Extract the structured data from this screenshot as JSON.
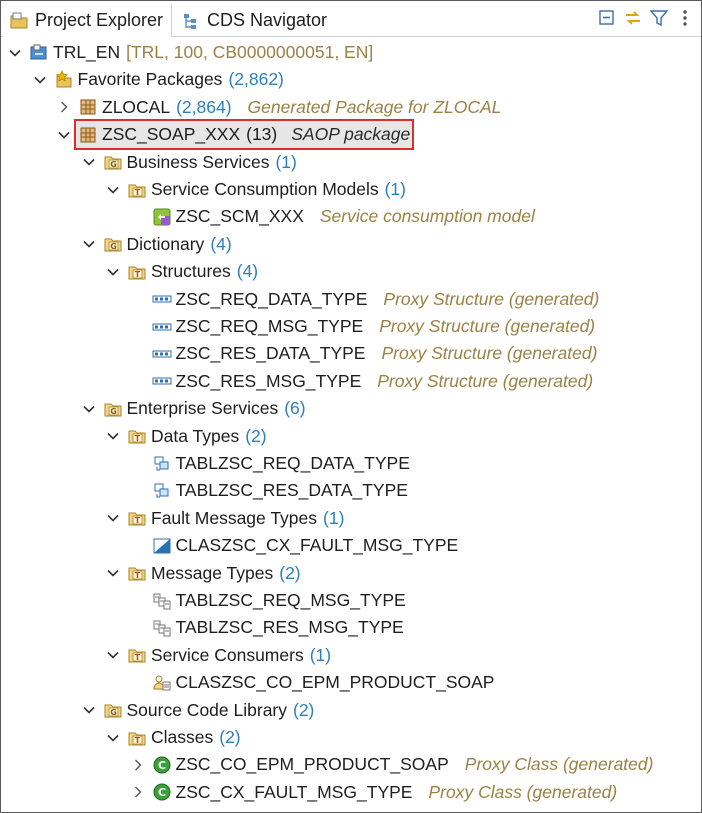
{
  "tabs": [
    {
      "label": "Project Explorer",
      "icon": "project-explorer-icon",
      "active": true
    },
    {
      "label": "CDS Navigator",
      "icon": "cds-navigator-icon",
      "active": false
    }
  ],
  "toolbar": [
    "collapse-all-icon",
    "link-with-editor-icon",
    "filter-icon",
    "view-menu-icon"
  ],
  "tree": [
    {
      "level": 0,
      "expanded": true,
      "icon": "project",
      "name": "TRL_EN",
      "count": "",
      "desc": "[TRL, 100, CB0000000051, EN]",
      "descStyle": "plain"
    },
    {
      "level": 1,
      "expanded": true,
      "icon": "favorites",
      "name": "Favorite Packages",
      "count": "(2,862)",
      "desc": ""
    },
    {
      "level": 2,
      "expanded": false,
      "icon": "package",
      "name": "ZLOCAL",
      "count": "(2,864)",
      "desc": "Generated Package for ZLOCAL"
    },
    {
      "level": 2,
      "expanded": true,
      "icon": "package",
      "name": "ZSC_SOAP_XXX",
      "count": "(13)",
      "desc": "SAOP package",
      "selected": true
    },
    {
      "level": 3,
      "expanded": true,
      "icon": "group",
      "name": "Business Services",
      "count": "(1)",
      "desc": ""
    },
    {
      "level": 4,
      "expanded": true,
      "icon": "type",
      "name": "Service Consumption Models",
      "count": "(1)",
      "desc": ""
    },
    {
      "level": 5,
      "leaf": true,
      "icon": "scm",
      "name": "ZSC_SCM_XXX",
      "count": "",
      "desc": "Service consumption model"
    },
    {
      "level": 3,
      "expanded": true,
      "icon": "group",
      "name": "Dictionary",
      "count": "(4)",
      "desc": ""
    },
    {
      "level": 4,
      "expanded": true,
      "icon": "type",
      "name": "Structures",
      "count": "(4)",
      "desc": ""
    },
    {
      "level": 5,
      "leaf": true,
      "icon": "structure",
      "name": "ZSC_REQ_DATA_TYPE",
      "count": "",
      "desc": "Proxy Structure (generated)"
    },
    {
      "level": 5,
      "leaf": true,
      "icon": "structure",
      "name": "ZSC_REQ_MSG_TYPE",
      "count": "",
      "desc": "Proxy Structure (generated)"
    },
    {
      "level": 5,
      "leaf": true,
      "icon": "structure",
      "name": "ZSC_RES_DATA_TYPE",
      "count": "",
      "desc": "Proxy Structure (generated)"
    },
    {
      "level": 5,
      "leaf": true,
      "icon": "structure",
      "name": "ZSC_RES_MSG_TYPE",
      "count": "",
      "desc": "Proxy Structure (generated)"
    },
    {
      "level": 3,
      "expanded": true,
      "icon": "group",
      "name": "Enterprise Services",
      "count": "(6)",
      "desc": ""
    },
    {
      "level": 4,
      "expanded": true,
      "icon": "type",
      "name": "Data Types",
      "count": "(2)",
      "desc": ""
    },
    {
      "level": 5,
      "leaf": true,
      "icon": "datatype",
      "name": "TABLZSC_REQ_DATA_TYPE",
      "count": "",
      "desc": ""
    },
    {
      "level": 5,
      "leaf": true,
      "icon": "datatype",
      "name": "TABLZSC_RES_DATA_TYPE",
      "count": "",
      "desc": ""
    },
    {
      "level": 4,
      "expanded": true,
      "icon": "type",
      "name": "Fault Message Types",
      "count": "(1)",
      "desc": ""
    },
    {
      "level": 5,
      "leaf": true,
      "icon": "fault",
      "name": "CLASZSC_CX_FAULT_MSG_TYPE",
      "count": "",
      "desc": ""
    },
    {
      "level": 4,
      "expanded": true,
      "icon": "type",
      "name": "Message Types",
      "count": "(2)",
      "desc": ""
    },
    {
      "level": 5,
      "leaf": true,
      "icon": "message",
      "name": "TABLZSC_REQ_MSG_TYPE",
      "count": "",
      "desc": ""
    },
    {
      "level": 5,
      "leaf": true,
      "icon": "message",
      "name": "TABLZSC_RES_MSG_TYPE",
      "count": "",
      "desc": ""
    },
    {
      "level": 4,
      "expanded": true,
      "icon": "type",
      "name": "Service Consumers",
      "count": "(1)",
      "desc": ""
    },
    {
      "level": 5,
      "leaf": true,
      "icon": "consumer",
      "name": "CLASZSC_CO_EPM_PRODUCT_SOAP",
      "count": "",
      "desc": ""
    },
    {
      "level": 3,
      "expanded": true,
      "icon": "group",
      "name": "Source Code Library",
      "count": "(2)",
      "desc": ""
    },
    {
      "level": 4,
      "expanded": true,
      "icon": "type",
      "name": "Classes",
      "count": "(2)",
      "desc": ""
    },
    {
      "level": 5,
      "expanded": false,
      "icon": "class",
      "name": "ZSC_CO_EPM_PRODUCT_SOAP",
      "count": "",
      "desc": "Proxy Class (generated)"
    },
    {
      "level": 5,
      "expanded": false,
      "icon": "class",
      "name": "ZSC_CX_FAULT_MSG_TYPE",
      "count": "",
      "desc": "Proxy Class (generated)"
    }
  ],
  "colors": {
    "count": "#2f7fb8",
    "description": "#9b8145",
    "selectionBorder": "#d9302c",
    "selectionFill": "#e6e6e6"
  }
}
